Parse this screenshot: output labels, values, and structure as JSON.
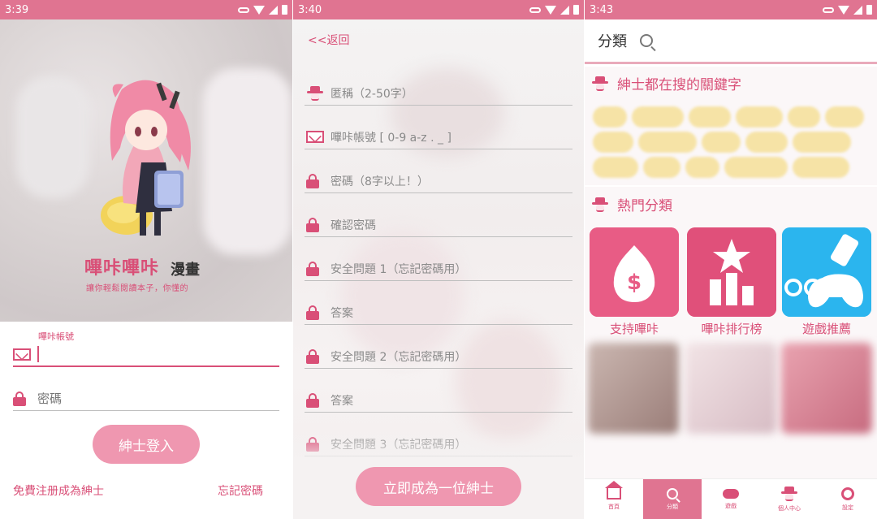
{
  "screens": [
    {
      "status_time": "3:39",
      "app": {
        "logo_title": "嗶咔嗶咔",
        "logo_title_suffix": "漫畫",
        "logo_tagline": "讓你輕鬆閱讀本子，你懂的"
      },
      "login": {
        "account_label": "嗶咔帳號",
        "account_value": "",
        "password_placeholder": "密碼",
        "login_button": "紳士登入",
        "register_link": "免費注册成為紳士",
        "forgot_link": "忘記密碼"
      }
    },
    {
      "status_time": "3:40",
      "back_label": "<<返回",
      "fields": [
        {
          "icon": "gentleman-icon",
          "placeholder": "匿稱（2-50字）"
        },
        {
          "icon": "mail-icon",
          "placeholder": "嗶咔帳號 [ 0-9 a-z . _ ]"
        },
        {
          "icon": "lock-icon",
          "placeholder": "密碼（8字以上！）"
        },
        {
          "icon": "lock-icon",
          "placeholder": "確認密碼"
        },
        {
          "icon": "lock-icon",
          "placeholder": "安全問題 1（忘記密碼用）"
        },
        {
          "icon": "lock-icon",
          "placeholder": "答案"
        },
        {
          "icon": "lock-icon",
          "placeholder": "安全問題 2（忘記密碼用）"
        },
        {
          "icon": "lock-icon",
          "placeholder": "答案"
        },
        {
          "icon": "lock-icon",
          "placeholder": "安全問題 3（忘記密碼用）"
        }
      ],
      "submit_button": "立即成為一位紳士"
    },
    {
      "status_time": "3:43",
      "title": "分類",
      "keywords_title": "紳士都在搜的關鍵字",
      "hot_title": "熱門分類",
      "categories": [
        {
          "label": "支持嗶咔",
          "color": "#e85c85"
        },
        {
          "label": "嗶咔排行榜",
          "color": "#e0507a"
        },
        {
          "label": "遊戲推薦",
          "color": "#2bb5ee"
        }
      ],
      "nav": [
        {
          "label": "首頁",
          "icon": "home-icon"
        },
        {
          "label": "分類",
          "icon": "search-icon"
        },
        {
          "label": "遊戲",
          "icon": "gamepad-icon"
        },
        {
          "label": "個人中心",
          "icon": "gentleman-icon"
        },
        {
          "label": "設定",
          "icon": "gear-icon"
        }
      ]
    }
  ],
  "colors": {
    "accent": "#d94f77",
    "statusbar": "#e07491",
    "button": "#ef97b0",
    "tag": "#f6e3a6"
  }
}
